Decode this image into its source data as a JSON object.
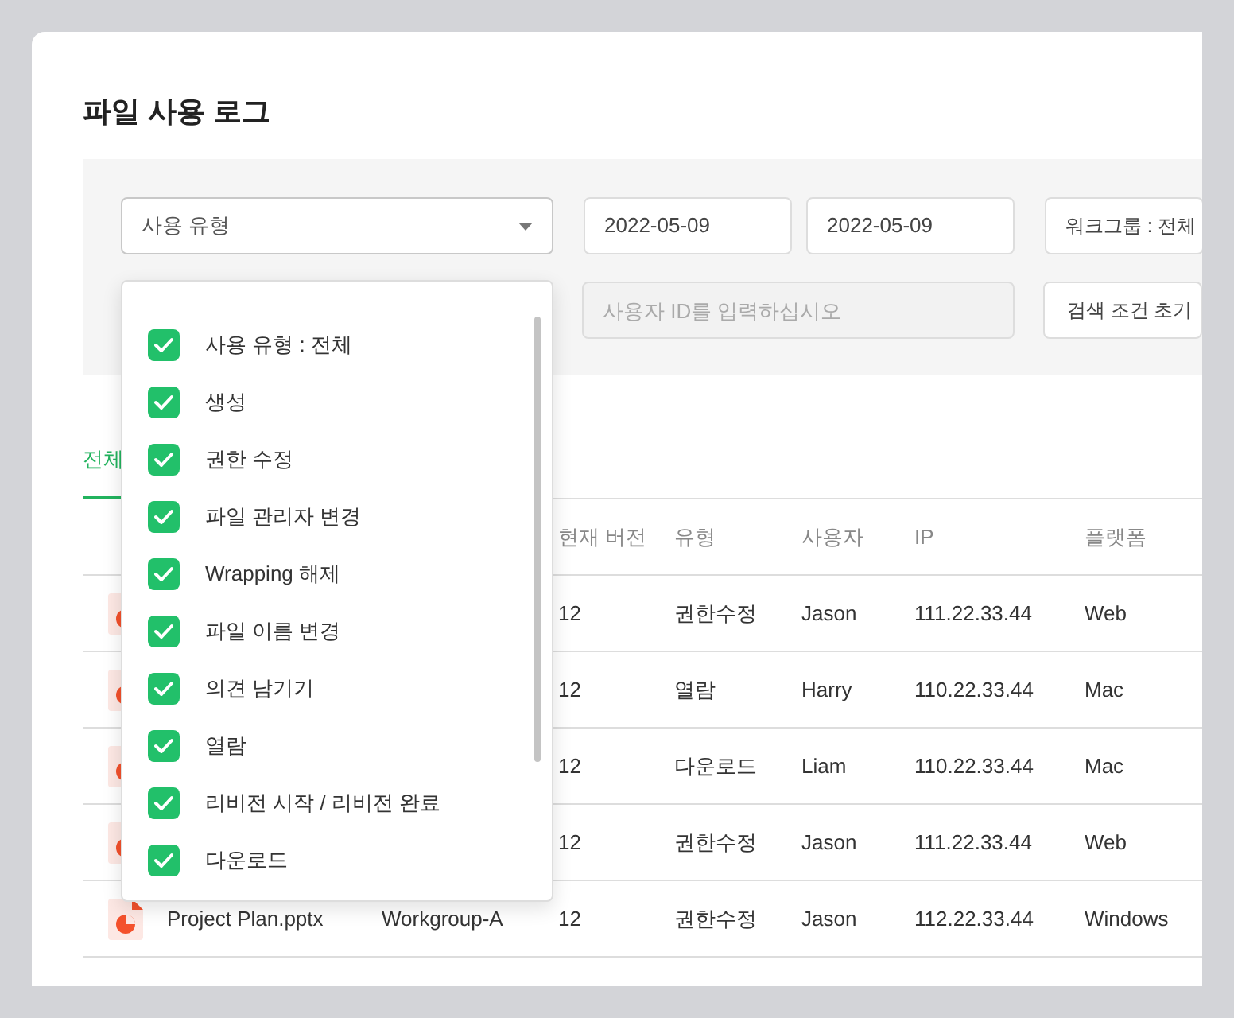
{
  "title": "파일 사용 로그",
  "filters": {
    "usage_type": {
      "label": "사용 유형",
      "open": true,
      "options": [
        {
          "label": "사용 유형 : 전체",
          "checked": true
        },
        {
          "label": "생성",
          "checked": true
        },
        {
          "label": "권한 수정",
          "checked": true
        },
        {
          "label": "파일 관리자 변경",
          "checked": true
        },
        {
          "label": "Wrapping 해제",
          "checked": true
        },
        {
          "label": "파일 이름 변경",
          "checked": true
        },
        {
          "label": "의견 남기기",
          "checked": true
        },
        {
          "label": "열람",
          "checked": true
        },
        {
          "label": "리비전 시작 / 리비전 완료",
          "checked": true
        },
        {
          "label": "다운로드",
          "checked": true
        }
      ]
    },
    "date_from": "2022-05-09",
    "date_to": "2022-05-09",
    "workgroup": "워크그룹 : 전체",
    "user_id": {
      "placeholder": "사용자 ID를 입력하십시오"
    },
    "reset_button": "검색 조건 초기"
  },
  "tabs": [
    {
      "label": "전체",
      "selected": true
    }
  ],
  "table": {
    "columns": [
      "현재 버전",
      "유형",
      "사용자",
      "IP",
      "플랫폼"
    ],
    "rows": [
      {
        "version": "12",
        "type": "권한수정",
        "user": "Jason",
        "ip": "111.22.33.44",
        "platform": "Web"
      },
      {
        "version": "12",
        "type": "열람",
        "user": "Harry",
        "ip": "110.22.33.44",
        "platform": "Mac"
      },
      {
        "version": "12",
        "type": "다운로드",
        "user": "Liam",
        "ip": "110.22.33.44",
        "platform": "Mac"
      },
      {
        "version": "12",
        "type": "권한수정",
        "user": "Jason",
        "ip": "111.22.33.44",
        "platform": "Web"
      },
      {
        "file": "Project Plan.pptx",
        "workgroup": "Workgroup-A",
        "version": "12",
        "type": "권한수정",
        "user": "Jason",
        "ip": "112.22.33.44",
        "platform": "Windows"
      }
    ]
  }
}
